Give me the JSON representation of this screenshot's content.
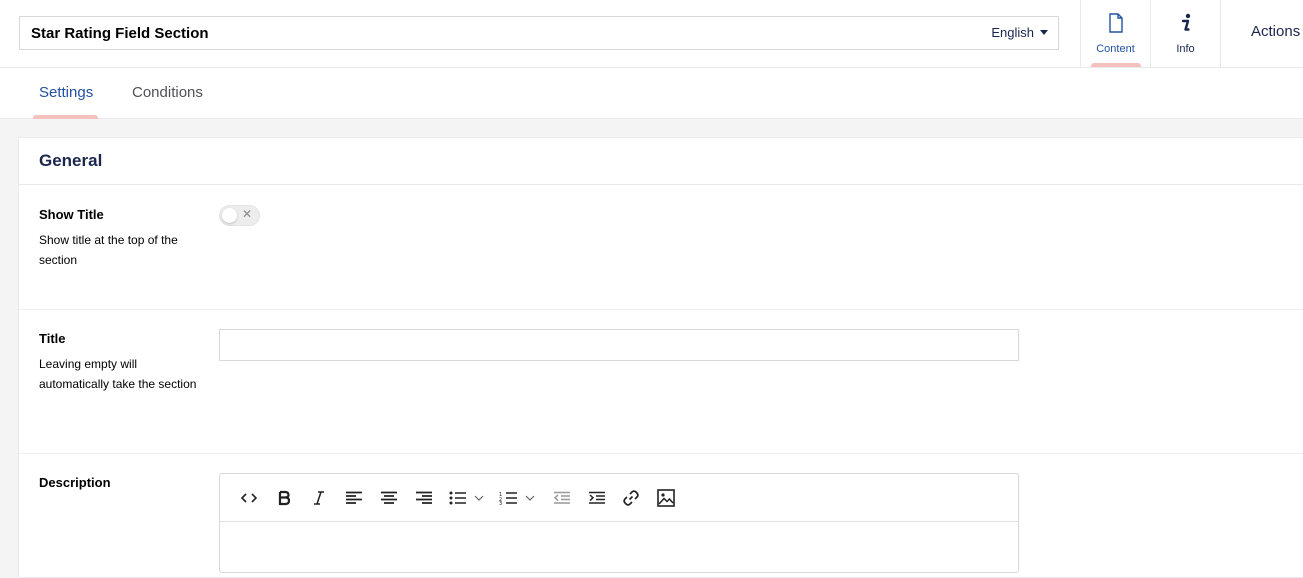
{
  "header": {
    "name": "Star Rating Field Section",
    "language": "English",
    "apps": [
      {
        "label": "Content",
        "icon": "document-icon",
        "active": true
      },
      {
        "label": "Info",
        "icon": "info-icon",
        "active": false
      }
    ],
    "actions_label": "Actions"
  },
  "tabs": [
    {
      "label": "Settings",
      "active": true
    },
    {
      "label": "Conditions",
      "active": false
    }
  ],
  "group": {
    "title": "General",
    "properties": [
      {
        "label": "Show Title",
        "description": "Show title at the top of the section",
        "editor": "toggle",
        "value": false
      },
      {
        "label": "Title",
        "description": "Leaving empty will automatically take the section",
        "editor": "text",
        "value": ""
      },
      {
        "label": "Description",
        "description": "",
        "editor": "richtext",
        "value": ""
      }
    ]
  },
  "rte_toolbar": [
    "source-code-icon",
    "bold-icon",
    "italic-icon",
    "align-left-icon",
    "align-center-icon",
    "align-right-icon",
    "bullet-list-icon",
    "numbered-list-icon",
    "outdent-icon",
    "indent-icon",
    "link-icon",
    "image-icon"
  ],
  "colors": {
    "accent": "#2152a3",
    "tab_indicator": "#f5c1bc",
    "text": "#1b264f"
  }
}
